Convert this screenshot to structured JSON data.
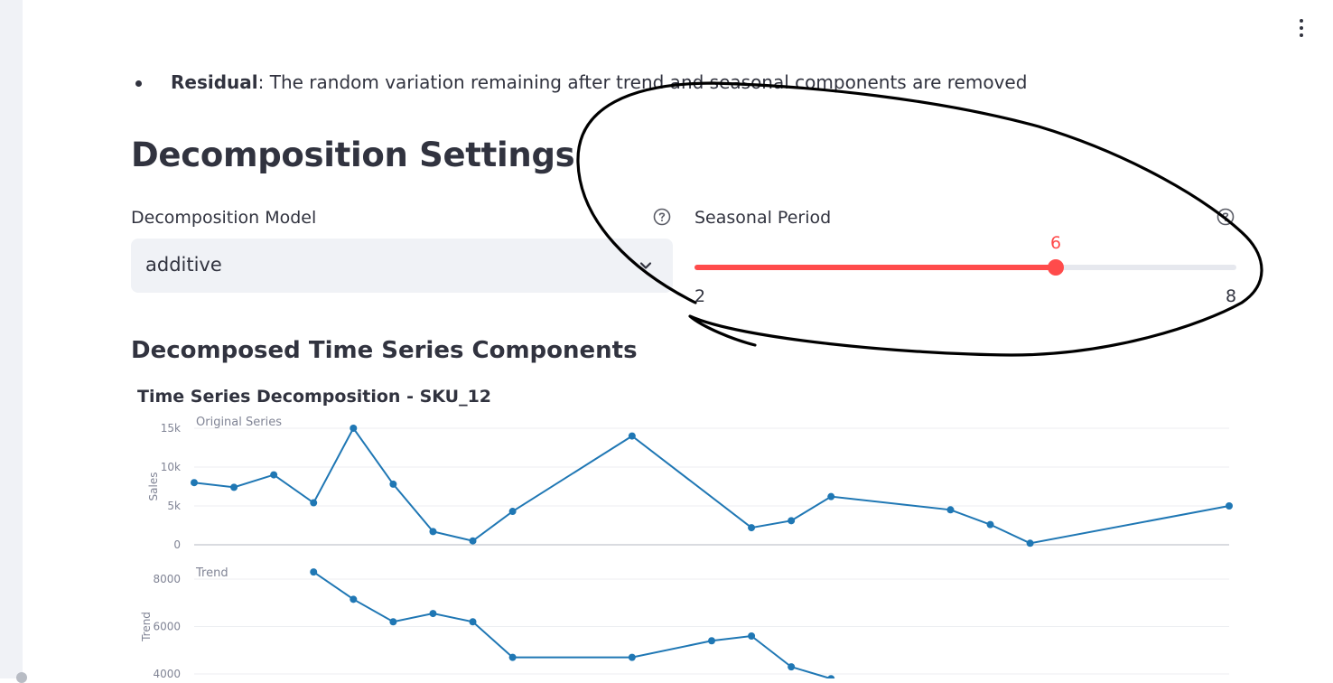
{
  "bullet": {
    "term": "Residual",
    "text": ": The random variation remaining after trend and seasonal components are removed"
  },
  "settings": {
    "heading": "Decomposition Settings",
    "model_label": "Decomposition Model",
    "model_value": "additive",
    "period_label": "Seasonal Period",
    "period_value": 6,
    "period_min": 2,
    "period_max": 8,
    "period_value_text": "6",
    "period_min_text": "2",
    "period_max_text": "8"
  },
  "section_heading": "Decomposed Time Series Components",
  "colors": {
    "accent": "#FF4B4B",
    "series": "#1F77B4",
    "text": "#31333F"
  },
  "chart_data": {
    "type": "line",
    "title": "Time Series Decomposition - SKU_12",
    "panels": [
      {
        "name": "Original Series",
        "ylabel": "Sales",
        "yticks": [
          "0",
          "5k",
          "10k",
          "15k"
        ],
        "ytick_values": [
          0,
          5000,
          10000,
          15000
        ],
        "x": [
          0,
          1,
          2,
          3,
          4,
          5,
          6,
          7,
          8,
          9,
          10,
          11,
          12,
          13,
          14,
          15,
          16,
          17,
          18,
          19,
          20,
          21,
          22,
          23,
          24,
          25,
          26
        ],
        "y": [
          8000,
          7400,
          9000,
          5400,
          15000,
          7800,
          1700,
          500,
          4300,
          null,
          null,
          14000,
          null,
          null,
          2200,
          3100,
          6200,
          null,
          null,
          4500,
          2600,
          200,
          null,
          null,
          null,
          null,
          5000
        ]
      },
      {
        "name": "Trend",
        "ylabel": "Trend",
        "yticks": [
          "4000",
          "6000",
          "8000"
        ],
        "ytick_values": [
          4000,
          6000,
          8000
        ],
        "x": [
          3,
          4,
          5,
          6,
          7,
          8,
          9,
          10,
          11,
          12,
          13,
          14,
          15,
          16
        ],
        "y": [
          8300,
          7150,
          6200,
          6550,
          6200,
          4700,
          null,
          null,
          4700,
          null,
          5400,
          5600,
          4300,
          3800
        ]
      }
    ]
  }
}
